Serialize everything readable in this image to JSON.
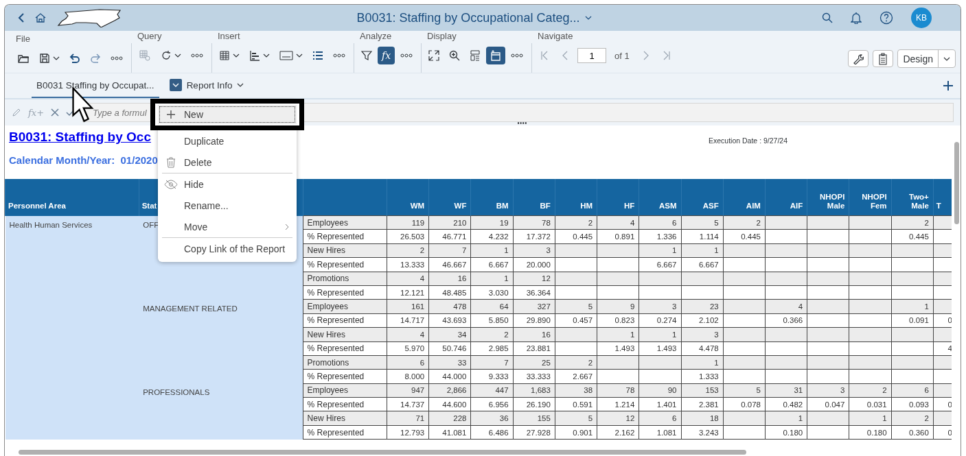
{
  "shell": {
    "title": "B0031: Staffing by Occupational Categ...",
    "avatar": "KB"
  },
  "toolbar": {
    "groups": [
      {
        "label": "File",
        "buttons": [
          {
            "kind": "open",
            "selected": false,
            "dropdown": false
          },
          {
            "kind": "save",
            "selected": false,
            "dropdown": true
          },
          {
            "kind": "undo",
            "selected": false,
            "dropdown": false
          },
          {
            "kind": "redo",
            "selected": false,
            "dropdown": false
          },
          {
            "kind": "more",
            "selected": false,
            "dropdown": false
          }
        ]
      },
      {
        "label": "Query",
        "buttons": [
          {
            "kind": "grid-gear",
            "selected": false,
            "dropdown": false
          },
          {
            "kind": "refresh",
            "selected": false,
            "dropdown": true
          },
          {
            "kind": "more",
            "selected": false,
            "dropdown": false
          }
        ]
      },
      {
        "label": "Insert",
        "buttons": [
          {
            "kind": "table",
            "selected": false,
            "dropdown": true
          },
          {
            "kind": "chart",
            "selected": false,
            "dropdown": true
          },
          {
            "kind": "textbox",
            "selected": false,
            "dropdown": true
          },
          {
            "kind": "list",
            "selected": false,
            "dropdown": false
          },
          {
            "kind": "more",
            "selected": false,
            "dropdown": false
          }
        ]
      },
      {
        "label": "Analyze",
        "buttons": [
          {
            "kind": "filter",
            "selected": false,
            "dropdown": false
          },
          {
            "kind": "formula",
            "text": "fx",
            "selected": true,
            "dropdown": false
          },
          {
            "kind": "more",
            "selected": false,
            "dropdown": false
          }
        ]
      },
      {
        "label": "Display",
        "buttons": [
          {
            "kind": "fullscreen",
            "selected": false,
            "dropdown": false
          },
          {
            "kind": "zoom",
            "selected": false,
            "dropdown": false
          },
          {
            "kind": "layout",
            "selected": false,
            "dropdown": false
          },
          {
            "kind": "panel",
            "selected": true,
            "dropdown": false
          },
          {
            "kind": "more",
            "selected": false,
            "dropdown": false
          }
        ]
      }
    ],
    "navigate": {
      "label": "Navigate",
      "page": "1",
      "of": "of 1"
    },
    "design": "Design"
  },
  "tabs": [
    {
      "label": "B0031 Staffing by Occupat...",
      "selected": true
    },
    {
      "label": "Report Info",
      "selected": false
    }
  ],
  "formula_bar": {
    "function_button": "fx+",
    "placeholder": "Type a formul"
  },
  "menu": [
    {
      "kind": "add",
      "label": "New",
      "focused": true,
      "submenu": false
    },
    {
      "kind": "plain",
      "label": "Duplicate",
      "focused": false,
      "submenu": false
    },
    {
      "kind": "delete",
      "label": "Delete",
      "focused": false,
      "submenu": false
    },
    {
      "kind": "separator"
    },
    {
      "kind": "hide",
      "label": "Hide",
      "focused": false,
      "submenu": false
    },
    {
      "kind": "plain",
      "label": "Rename...",
      "focused": false,
      "submenu": false
    },
    {
      "kind": "plain",
      "label": "Move",
      "focused": false,
      "submenu": true
    },
    {
      "kind": "separator"
    },
    {
      "kind": "plain",
      "label": "Copy Link of the Report",
      "focused": false,
      "submenu": false
    }
  ],
  "report": {
    "title": "B0031: Staffing by Occ",
    "execution_date": "Execution Date : 9/27/24",
    "calendar": "Calendar Month/Year:  01/2020",
    "columns": [
      "Personnel Area",
      "Stat",
      "",
      "WM",
      "WF",
      "BM",
      "BF",
      "HM",
      "HF",
      "ASM",
      "ASF",
      "AIM",
      "AIF",
      "NHOPI Male",
      "NHOPI Fem",
      "Two+ Male",
      "T"
    ],
    "personnel_area": "Health Human Services",
    "groups": [
      {
        "state": "OFF",
        "rows": [
          {
            "label": "Employees",
            "shaded": true,
            "cells": [
              "119",
              "210",
              "19",
              "78",
              "2",
              "4",
              "6",
              "5",
              "2",
              null,
              null,
              null,
              "2",
              null
            ]
          },
          {
            "label": "% Represented",
            "shaded": false,
            "cells": [
              "26.503",
              "46.771",
              "4.232",
              "17.372",
              "0.445",
              "0.891",
              "1.336",
              "1.114",
              "0.445",
              null,
              null,
              null,
              "0.445",
              null
            ]
          },
          {
            "label": "New Hires",
            "shaded": true,
            "cells": [
              "2",
              "7",
              "1",
              "3",
              null,
              null,
              "1",
              "1",
              null,
              null,
              null,
              null,
              null,
              null
            ]
          },
          {
            "label": "% Represented",
            "shaded": false,
            "cells": [
              "13.333",
              "46.667",
              "6.667",
              "20.000",
              null,
              null,
              "6.667",
              "6.667",
              null,
              null,
              null,
              null,
              null,
              null
            ]
          },
          {
            "label": "Promotions",
            "shaded": true,
            "cells": [
              "4",
              "16",
              "1",
              "12",
              null,
              null,
              null,
              null,
              null,
              null,
              null,
              null,
              null,
              null
            ]
          },
          {
            "label": "% Represented",
            "shaded": false,
            "cells": [
              "12.121",
              "48.485",
              "3.030",
              "36.364",
              null,
              null,
              null,
              null,
              null,
              null,
              null,
              null,
              null,
              null
            ]
          }
        ]
      },
      {
        "state": "MANAGEMENT RELATED",
        "rows": [
          {
            "label": "Employees",
            "shaded": true,
            "cells": [
              "161",
              "478",
              "64",
              "327",
              "5",
              "9",
              "3",
              "23",
              null,
              "4",
              null,
              null,
              "1",
              null
            ]
          },
          {
            "label": "% Represented",
            "shaded": false,
            "cells": [
              "14.717",
              "43.693",
              "5.850",
              "29.890",
              "0.457",
              "0.823",
              "0.274",
              "2.102",
              null,
              "0.366",
              null,
              null,
              "0.091",
              "0"
            ]
          },
          {
            "label": "New Hires",
            "shaded": true,
            "cells": [
              "4",
              "34",
              "2",
              "16",
              null,
              "1",
              "1",
              "3",
              null,
              null,
              null,
              null,
              null,
              null
            ]
          },
          {
            "label": "% Represented",
            "shaded": false,
            "cells": [
              "5.970",
              "50.746",
              "2.985",
              "23.881",
              null,
              "1.493",
              "1.493",
              "4.478",
              null,
              null,
              null,
              null,
              null,
              "4"
            ]
          },
          {
            "label": "Promotions",
            "shaded": true,
            "cells": [
              "6",
              "33",
              "7",
              "25",
              "2",
              null,
              null,
              "1",
              null,
              null,
              null,
              null,
              null,
              null
            ]
          },
          {
            "label": "% Represented",
            "shaded": false,
            "cells": [
              "8.000",
              "44.000",
              "9.333",
              "33.333",
              "2.667",
              null,
              null,
              "1.333",
              null,
              null,
              null,
              null,
              null,
              null
            ]
          }
        ]
      },
      {
        "state": "PROFESSIONALS",
        "rows": [
          {
            "label": "Employees",
            "shaded": true,
            "cells": [
              "947",
              "2,866",
              "447",
              "1,683",
              "38",
              "78",
              "90",
              "153",
              "5",
              "31",
              "3",
              "2",
              "6",
              null
            ]
          },
          {
            "label": "% Represented",
            "shaded": false,
            "cells": [
              "14.737",
              "44.600",
              "6.956",
              "26.190",
              "0.591",
              "1.214",
              "1.401",
              "2.381",
              "0.078",
              "0.482",
              "0.047",
              "0.031",
              "0.093",
              "0"
            ]
          },
          {
            "label": "New Hires",
            "shaded": true,
            "cells": [
              "71",
              "228",
              "36",
              "155",
              "5",
              "12",
              "6",
              "18",
              null,
              "1",
              null,
              "1",
              "2",
              null
            ]
          },
          {
            "label": "% Represented",
            "shaded": false,
            "cells": [
              "12.793",
              "41.081",
              "6.486",
              "27.928",
              "0.901",
              "2.162",
              "1.081",
              "3.243",
              null,
              "0.180",
              null,
              "0.180",
              "0.360",
              "0"
            ]
          }
        ]
      }
    ]
  }
}
